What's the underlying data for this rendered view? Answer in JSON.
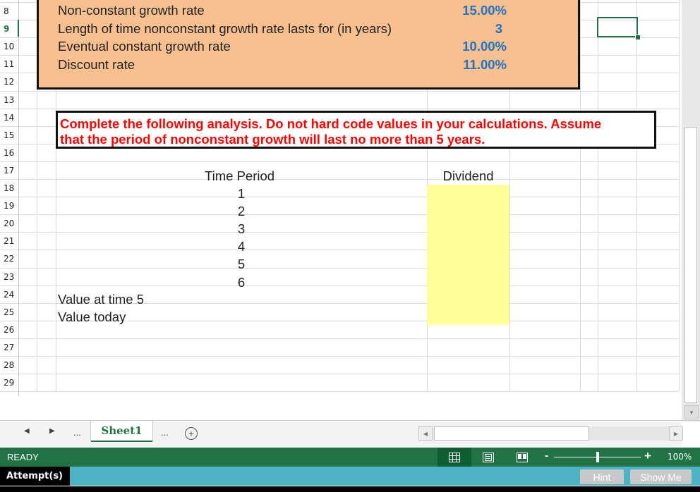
{
  "spreadsheet": {
    "row_numbers": [
      "8",
      "9",
      "10",
      "11",
      "12",
      "13",
      "14",
      "15",
      "16",
      "17",
      "18",
      "19",
      "20",
      "21",
      "22",
      "23",
      "24",
      "25",
      "26",
      "27",
      "28",
      "29"
    ],
    "selected_row": "9",
    "inputs": [
      {
        "label": "Non-constant growth rate",
        "value": "15.00%"
      },
      {
        "label": "Length of time nonconstant growth rate lasts for (in years)",
        "value": "3"
      },
      {
        "label": "Eventual constant growth rate",
        "value": "10.00%"
      },
      {
        "label": "Discount rate",
        "value": "11.00%"
      }
    ],
    "instruction_line1": "Complete the following analysis. Do not hard code values in your calculations. Assume",
    "instruction_line2": "that the period of nonconstant growth will last no more than 5 years.",
    "table": {
      "header_time_period": "Time Period",
      "header_dividend": "Dividend",
      "periods": [
        "1",
        "2",
        "3",
        "4",
        "5",
        "6"
      ],
      "value_at_time_5_label": "Value at time 5",
      "value_today_label": "Value today"
    },
    "colors": {
      "input_box_fill": "#f8bf8f",
      "input_value": "#1f74c4",
      "instruction_text": "#ff0000",
      "answer_fill": "#ffff99",
      "excel_green": "#217346"
    }
  },
  "sheet_tabs": {
    "active_tab": "Sheet1",
    "prev_icon": "◀",
    "next_icon": "▶",
    "ellipsis": "...",
    "add_icon": "+"
  },
  "status_bar": {
    "status": "READY",
    "zoom_minus": "-",
    "zoom_plus": "+",
    "zoom_level": "100%",
    "zoom_fraction": 0.5
  },
  "bottom_bar": {
    "attempts_label": "Attempt(s)",
    "hint_label": "Hint",
    "show_me_label": "Show Me"
  }
}
